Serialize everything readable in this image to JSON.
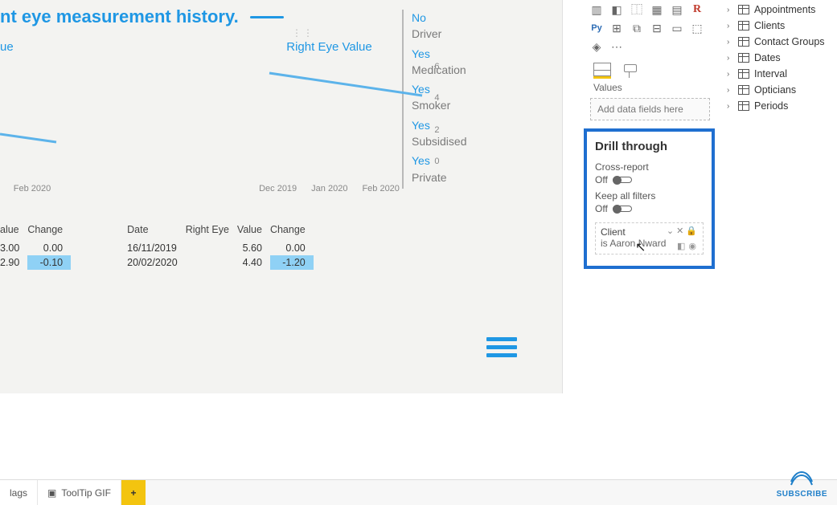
{
  "header": {
    "title": "nt eye measurement history."
  },
  "filters": [
    {
      "answer": "No",
      "label": "Driver"
    },
    {
      "answer": "Yes",
      "label": "Medication"
    },
    {
      "answer": "Yes",
      "label": "Smoker"
    },
    {
      "answer": "Yes",
      "label": "Subsidised"
    },
    {
      "answer": "Yes",
      "label": "Private"
    }
  ],
  "left_chart": {
    "title": "ue",
    "x_ticks": [
      "Feb 2020"
    ]
  },
  "right_chart": {
    "title": "Right Eye Value",
    "y_ticks": [
      "6",
      "4",
      "2",
      "0"
    ],
    "x_ticks": [
      "Dec 2019",
      "Jan 2020",
      "Feb 2020"
    ]
  },
  "chart_data": [
    {
      "type": "line",
      "title": "Right Eye Value",
      "x": [
        "Dec 2019",
        "Jan 2020",
        "Feb 2020"
      ],
      "values": [
        5.6,
        5.0,
        4.4
      ],
      "ylim": [
        0,
        6
      ]
    }
  ],
  "left_table": {
    "columns": [
      "alue",
      "Change"
    ],
    "rows": [
      {
        "value": "3.00",
        "change": "0.00",
        "hl": false
      },
      {
        "value": "2.90",
        "change": "-0.10",
        "hl": true
      }
    ]
  },
  "right_table": {
    "columns": [
      "Date",
      "Right Eye",
      "Value",
      "Change"
    ],
    "rows": [
      {
        "date": "16/11/2019",
        "righteye": "",
        "value": "5.60",
        "change": "0.00",
        "hl": false
      },
      {
        "date": "20/02/2020",
        "righteye": "",
        "value": "4.40",
        "change": "-1.20",
        "hl": true
      }
    ]
  },
  "tabs": {
    "prev_partial": "lags",
    "tooltip": "ToolTip GIF",
    "add": "+"
  },
  "viz": {
    "values_label": "Values",
    "well_placeholder": "Add data fields here"
  },
  "drill": {
    "title": "Drill through",
    "cross": "Cross-report",
    "keep": "Keep all filters",
    "off": "Off",
    "field_name": "Client",
    "field_value": "is Aaron Nward"
  },
  "fields": [
    "Appointments",
    "Clients",
    "Contact Groups",
    "Dates",
    "Interval",
    "Opticians",
    "Periods"
  ],
  "subscribe": "SUBSCRIBE"
}
